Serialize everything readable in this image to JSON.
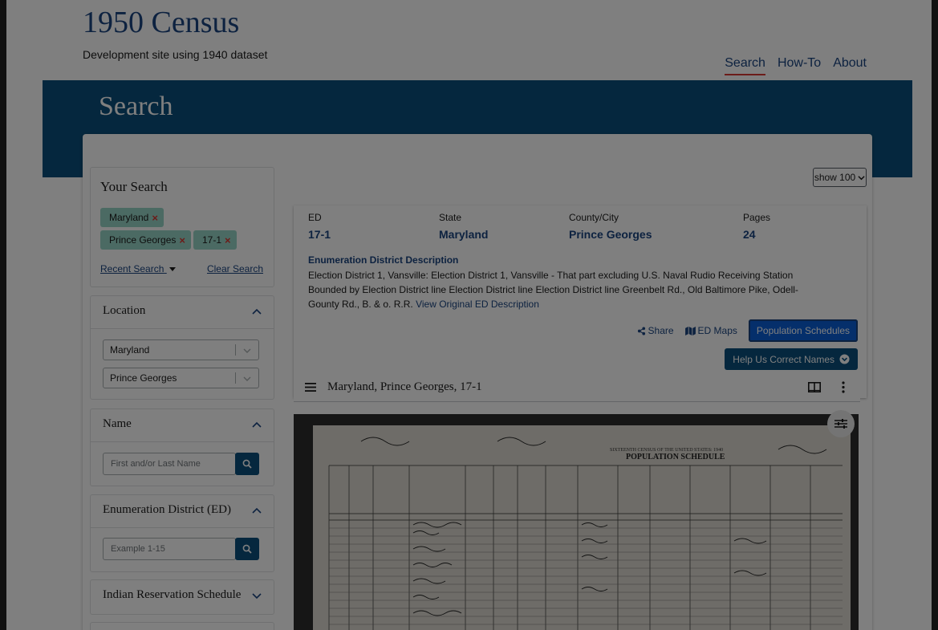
{
  "header": {
    "title": "1950 Census",
    "subtitle": "Development site using 1940 dataset",
    "nav": [
      {
        "label": "Search"
      },
      {
        "label": "How-To"
      },
      {
        "label": "About"
      }
    ]
  },
  "banner": {
    "title": "Search"
  },
  "results_control": {
    "show_select": "show 100"
  },
  "your_search": {
    "heading": "Your Search",
    "tags": [
      {
        "label": "Maryland"
      },
      {
        "label": "Prince Georges"
      },
      {
        "label": "17-1"
      }
    ],
    "recent_search": "Recent Search",
    "clear_search": "Clear Search"
  },
  "location": {
    "heading": "Location",
    "state_value": "Maryland",
    "county_value": "Prince Georges"
  },
  "name": {
    "heading": "Name",
    "placeholder": "First and/or Last Name"
  },
  "ed": {
    "heading": "Enumeration District (ED)",
    "placeholder": "Example 1-15"
  },
  "indian": {
    "heading": "Indian Reservation Schedule"
  },
  "result": {
    "ed_label": "ED",
    "ed_value": "17-1",
    "state_label": "State",
    "state_value": "Maryland",
    "county_label": "County/City",
    "county_value": "Prince Georges",
    "pages_label": "Pages",
    "pages_value": "24",
    "desc_heading": "Enumeration District Description",
    "desc_text": "Election District 1, Vansville: Election District 1, Vansville - That part excluding U.S. Naval Rudio Receiving Station Bounded by Election District line Election District line Election District line Greenbelt Rd., Old Baltimore Pike, Odell-Gounty Rd., B. & o. R.R.",
    "view_original": "View Original ED Description",
    "share": "Share",
    "ed_maps": "ED Maps",
    "population_schedules": "Population Schedules",
    "help_correct": "Help Us Correct Names"
  },
  "viewer": {
    "title": "Maryland, Prince Georges, 17-1"
  },
  "scan_text": {
    "header_title": "POPULATION SCHEDULE",
    "subheader": "SIXTEENTH CENSUS OF THE UNITED STATES: 1940"
  }
}
